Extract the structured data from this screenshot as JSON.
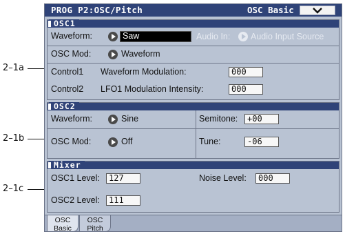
{
  "annotations": [
    "2–1a",
    "2–1b",
    "2–1c"
  ],
  "header": {
    "title": "PROG P2:OSC/Pitch",
    "page_name": "OSC Basic",
    "menu_icon": "chevron-down-icon"
  },
  "osc1": {
    "title": "OSC1",
    "waveform_label": "Waveform:",
    "waveform_value": "Saw",
    "audio_in_label": "Audio In:",
    "audio_in_value": "Audio Input Source",
    "osc_mod_label": "OSC Mod:",
    "osc_mod_value": "Waveform",
    "control1_label": "Control1",
    "control1_param": "Waveform Modulation:",
    "control1_value": "000",
    "control2_label": "Control2",
    "control2_param": "LFO1 Modulation Intensity:",
    "control2_value": "000"
  },
  "osc2": {
    "title": "OSC2",
    "waveform_label": "Waveform:",
    "waveform_value": "Sine",
    "osc_mod_label": "OSC Mod:",
    "osc_mod_value": "Off",
    "semitone_label": "Semitone:",
    "semitone_value": "+00",
    "tune_label": "Tune:",
    "tune_value": "-06"
  },
  "mixer": {
    "title": "Mixer",
    "osc1_level_label": "OSC1 Level:",
    "osc1_level_value": "127",
    "osc2_level_label": "OSC2 Level:",
    "osc2_level_value": "111",
    "noise_level_label": "Noise Level:",
    "noise_level_value": "000"
  },
  "tabs": [
    {
      "line1": "OSC",
      "line2": "Basic",
      "active": true
    },
    {
      "line1": "OSC",
      "line2": "Pitch",
      "active": false
    }
  ]
}
